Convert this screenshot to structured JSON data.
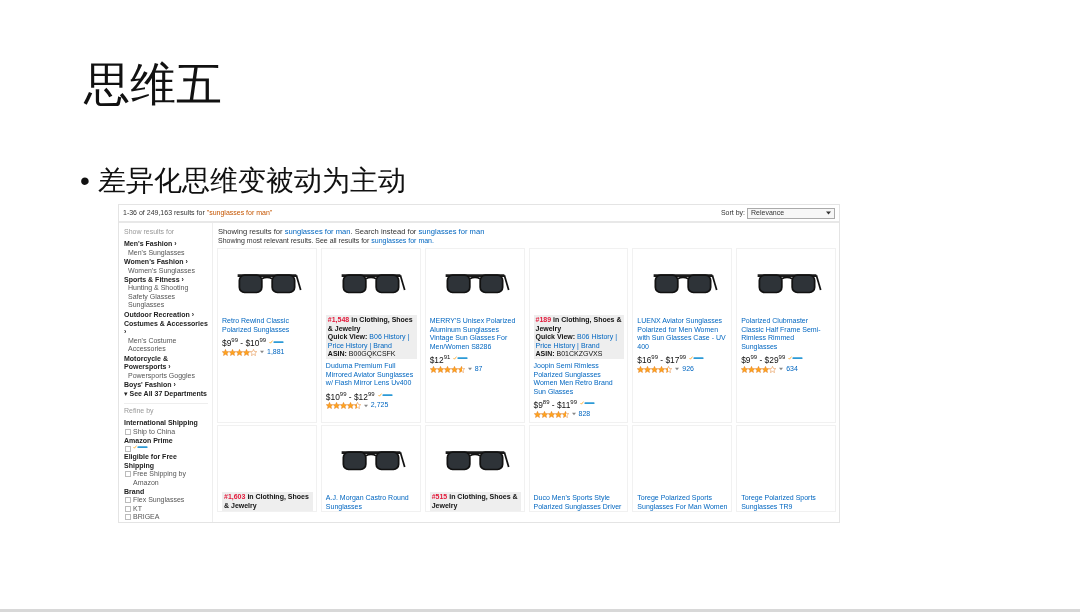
{
  "slide": {
    "title": "思维五",
    "bullets": [
      {
        "marker": "•",
        "text": "差异化思维变被动为主动"
      }
    ]
  },
  "screenshot": {
    "results_summary": {
      "text": "1-36 of 249,163 results for ",
      "query": "\"sunglasses for man\""
    },
    "sort": {
      "label": "Sort by:",
      "value": "Relevance"
    },
    "sidebar": [
      {
        "kind": "section",
        "text": "Show results for"
      },
      {
        "kind": "category",
        "text": "Men's Fashion ›"
      },
      {
        "kind": "link",
        "text": "Men's Sunglasses"
      },
      {
        "kind": "category",
        "text": "Women's Fashion ›"
      },
      {
        "kind": "link",
        "text": "Women's Sunglasses"
      },
      {
        "kind": "category",
        "text": "Sports & Fitness ›"
      },
      {
        "kind": "link",
        "text": "Hunting & Shooting Safety Glasses"
      },
      {
        "kind": "link",
        "text": "Sunglasses"
      },
      {
        "kind": "category",
        "text": "Outdoor Recreation ›"
      },
      {
        "kind": "category",
        "text": "Costumes & Accessories ›"
      },
      {
        "kind": "link",
        "text": "Men's Costume Accessories"
      },
      {
        "kind": "category",
        "text": "Motorcycle & Powersports ›"
      },
      {
        "kind": "link",
        "text": "Powersports Goggles"
      },
      {
        "kind": "category",
        "text": "Boys' Fashion ›"
      },
      {
        "kind": "more",
        "text": "▾ See All 37 Departments"
      },
      {
        "kind": "section",
        "text": "Refine by"
      },
      {
        "kind": "heading",
        "text": "International Shipping"
      },
      {
        "kind": "checkbox",
        "text": "Ship to China",
        "checked": false
      },
      {
        "kind": "heading",
        "text": "Amazon Prime"
      },
      {
        "kind": "prime",
        "checked": false
      },
      {
        "kind": "heading",
        "text": "Eligible for Free Shipping"
      },
      {
        "kind": "checkbox",
        "text": "Free Shipping by Amazon",
        "checked": false
      },
      {
        "kind": "heading",
        "text": "Brand"
      },
      {
        "kind": "checkbox",
        "text": "Flex Sunglasses",
        "checked": false
      },
      {
        "kind": "checkbox",
        "text": "KT",
        "checked": false
      },
      {
        "kind": "checkbox",
        "text": "BRIGEA",
        "checked": false
      }
    ],
    "notice": {
      "text": "Showing results for ",
      "link": "sunglasses for man",
      "text_2": ". Search instead for ",
      "link_2": "sunglasses for man"
    },
    "sub_notice": {
      "text": "Showing most relevant results. See all results for ",
      "link": "sunglasses for man."
    },
    "products": [
      {
        "photo": true,
        "title": "Retro Rewind Classic Polarized Sunglasses",
        "price": "$9$^{99}$ - $10$^{99}$",
        "prime": true,
        "stars": 4,
        "reviews": "1,881"
      },
      {
        "photo": true,
        "rank": "#1,548",
        "category": "in Clothing, Shoes & Jewelry",
        "quick_view_label": "Quick View:",
        "quick_view_links": "B06 History | Price History | Brand",
        "asin_label": "ASIN:",
        "asin": "B00GQKCSFK",
        "title": "Duduma Premium Full Mirrored Aviator Sunglasses w/ Flash Mirror Lens Uv400",
        "price": "$10$^{99}$ - $12$^{99}$",
        "prime": true,
        "stars": 4.5,
        "reviews": "2,725"
      },
      {
        "photo": true,
        "title": "MERRY'S Unisex Polarized Aluminum Sunglasses Vintage Sun Glasses For Men/Women S8286",
        "price": "$12$^{91}$",
        "prime": true,
        "stars": 4.5,
        "reviews": "87"
      },
      {
        "photo": false,
        "rank": "#189",
        "category": "in Clothing, Shoes & Jewelry",
        "quick_view_label": "Quick View:",
        "quick_view_links": "B06 History | Price History | Brand",
        "asin_label": "ASIN:",
        "asin": "B01CKZGVXS",
        "title": "Joopin Semi Rimless Polarized Sunglasses Women Men Retro Brand Sun Glasses",
        "price": "$9$^{89}$ - $11$^{99}$",
        "prime": true,
        "stars": 4.5,
        "reviews": "828"
      },
      {
        "photo": true,
        "title": "LUENX Aviator Sunglasses Polarized for Men Women with Sun Glasses Case - UV 400",
        "price": "$16$^{99}$ - $17$^{99}$",
        "prime": true,
        "stars": 4.5,
        "reviews": "926"
      },
      {
        "photo": true,
        "title": "Polarized Clubmaster Classic Half Frame Semi-Rimless Rimmed Sunglasses",
        "price": "$9$^{99}$ - $29$^{99}$",
        "prime": true,
        "stars": 4,
        "reviews": "634"
      },
      {
        "photo": false,
        "rank": "#1,603",
        "category": "in Clothing, Shoes & Jewelry"
      },
      {
        "photo": true,
        "title": "A.J. Morgan Castro Round Sunglasses"
      },
      {
        "photo": true,
        "rank": "#515",
        "category": "in Clothing, Shoes & Jewelry"
      },
      {
        "photo": false,
        "title": "Duco Men's Sports Style Polarized Sunglasses Driver"
      },
      {
        "photo": false,
        "title": "Torege Polarized Sports Sunglasses For Man Women"
      },
      {
        "photo": false,
        "title": "Torege Polarized Sports Sunglasses TR9"
      }
    ]
  }
}
